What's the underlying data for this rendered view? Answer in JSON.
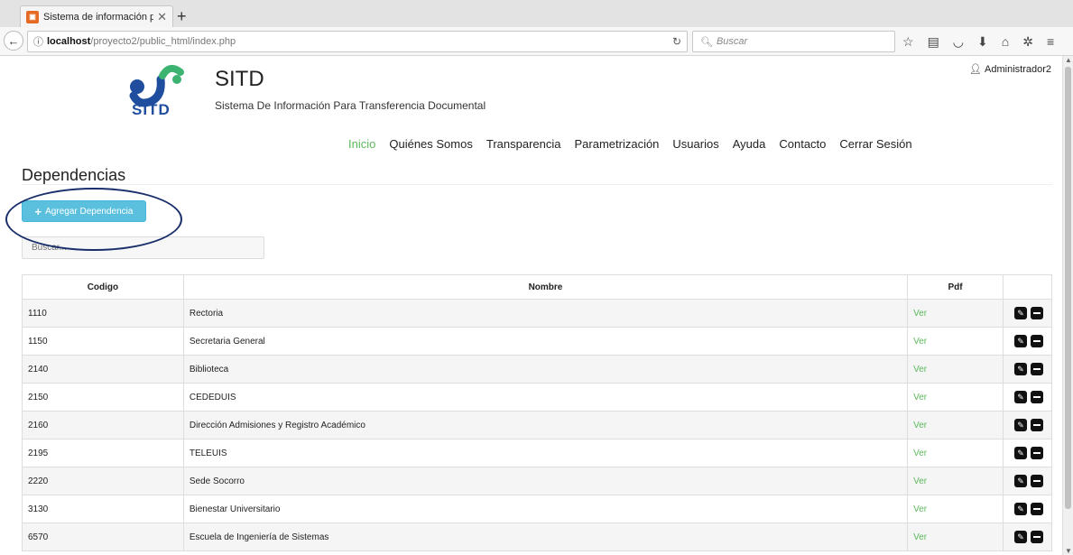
{
  "browser": {
    "tab_title": "Sistema de información par",
    "tab_favicon": "xampp-icon",
    "url_host": "localhost",
    "url_path": "/proyecto2/public_html/index.php",
    "search_placeholder": "Buscar"
  },
  "header": {
    "logo_text": "SITD",
    "site_title": "SITD",
    "site_subtitle": "Sistema De Información Para Transferencia Documental",
    "user_name": "Administrador2"
  },
  "menu": [
    {
      "label": "Inicio",
      "active": true
    },
    {
      "label": "Quiénes Somos"
    },
    {
      "label": "Transparencia"
    },
    {
      "label": "Parametrización"
    },
    {
      "label": "Usuarios"
    },
    {
      "label": "Ayuda"
    },
    {
      "label": "Contacto"
    },
    {
      "label": "Cerrar Sesión"
    }
  ],
  "main": {
    "section_title": "Dependencias",
    "add_button_label": "Agregar Dependencia",
    "search_placeholder": "Buscar..."
  },
  "table": {
    "headers": [
      "Codigo",
      "Nombre",
      "Pdf",
      ""
    ],
    "link_label": "Ver",
    "rows": [
      {
        "codigo": "1110",
        "nombre": "Rectoria"
      },
      {
        "codigo": "1150",
        "nombre": "Secretaria General"
      },
      {
        "codigo": "2140",
        "nombre": "Biblioteca"
      },
      {
        "codigo": "2150",
        "nombre": "CEDEDUIS"
      },
      {
        "codigo": "2160",
        "nombre": "Dirección Admisiones y Registro Académico"
      },
      {
        "codigo": "2195",
        "nombre": "TELEUIS"
      },
      {
        "codigo": "2220",
        "nombre": "Sede Socorro"
      },
      {
        "codigo": "3130",
        "nombre": "Bienestar Universitario"
      },
      {
        "codigo": "6570",
        "nombre": "Escuela de Ingeniería de Sistemas"
      }
    ]
  },
  "colors": {
    "accent_green": "#5cb85c",
    "info_button": "#5bc0de",
    "brand_blue": "#1f4e9e",
    "annotation_ellipse": "#1a2f6b"
  }
}
